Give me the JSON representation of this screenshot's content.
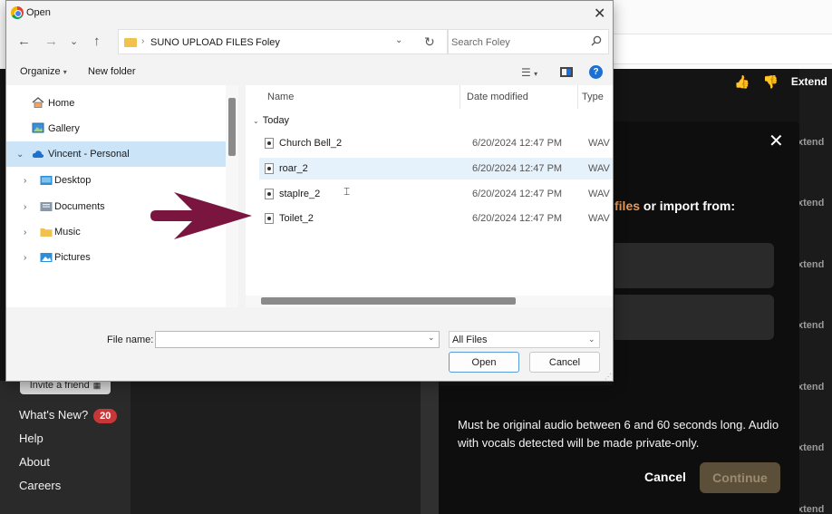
{
  "dialog": {
    "title": "Open",
    "breadcrumbs": [
      "SUNO UPLOAD FILES",
      "Foley"
    ],
    "search_placeholder": "Search Foley",
    "organize_label": "Organize",
    "new_folder_label": "New folder",
    "nav_items": [
      {
        "label": "Home",
        "icon": "home-icon"
      },
      {
        "label": "Gallery",
        "icon": "gallery-icon"
      },
      {
        "label": "Vincent - Personal",
        "icon": "cloud-icon",
        "selected": true
      },
      {
        "label": "Desktop",
        "icon": "desktop-folder-icon"
      },
      {
        "label": "Documents",
        "icon": "documents-folder-icon"
      },
      {
        "label": "Music",
        "icon": "music-folder-icon"
      },
      {
        "label": "Pictures",
        "icon": "pictures-folder-icon"
      }
    ],
    "columns": {
      "name": "Name",
      "date": "Date modified",
      "type": "Type"
    },
    "group_label": "Today",
    "files": [
      {
        "name": "Church Bell_2",
        "date": "6/20/2024 12:47 PM",
        "type": "WAV File"
      },
      {
        "name": "roar_2",
        "date": "6/20/2024 12:47 PM",
        "type": "WAV File",
        "selected": true
      },
      {
        "name": "staplre_2",
        "date": "6/20/2024 12:47 PM",
        "type": "WAV File"
      },
      {
        "name": "Toilet_2",
        "date": "6/20/2024 12:47 PM",
        "type": "WAV File"
      }
    ],
    "file_name_label": "File name:",
    "file_name_value": "",
    "file_type_selected": "All Files",
    "open_label": "Open",
    "cancel_label": "Cancel"
  },
  "app": {
    "extend_label": "Extend",
    "extend_col_label": "xtend",
    "invite_label": "Invite a friend",
    "sidebar_links": [
      {
        "label": "What's New?",
        "badge": "20"
      },
      {
        "label": "Help"
      },
      {
        "label": "About"
      },
      {
        "label": "Careers"
      }
    ]
  },
  "modal": {
    "prompt_highlight": "files",
    "prompt_rest": " or import from:",
    "note": "Must be original audio between 6 and 60 seconds long. Audio with vocals detected will be made private-only.",
    "cancel_label": "Cancel",
    "continue_label": "Continue"
  },
  "colors": {
    "selection": "#cce4f7",
    "row_selection": "#e5f1fb",
    "accent_blue": "#1f6fd1",
    "arrow": "#7a1540",
    "badge": "#c83737",
    "continue_bg": "#5c4f3a"
  }
}
